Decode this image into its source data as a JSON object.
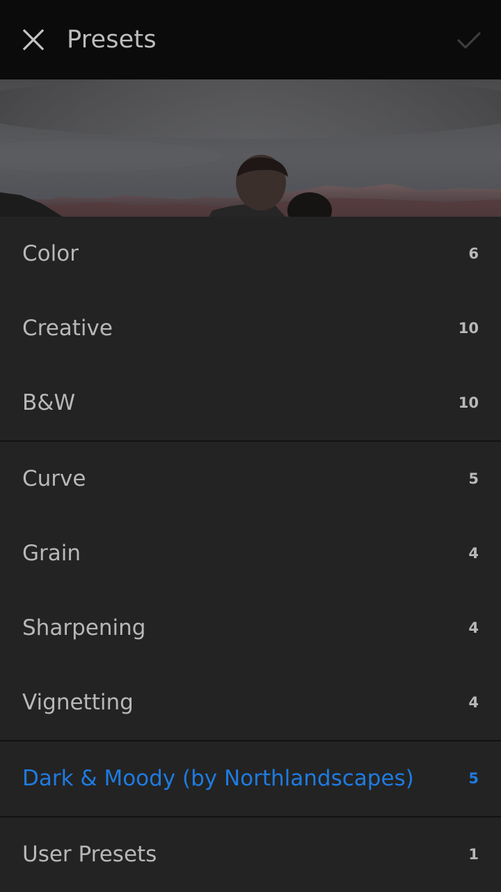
{
  "header": {
    "title": "Presets",
    "close_icon": "close-icon",
    "confirm_icon": "checkmark-icon"
  },
  "preview": {
    "description_icon": "photo-preview"
  },
  "groups": [
    {
      "items": [
        {
          "label": "Color",
          "count": "6"
        },
        {
          "label": "Creative",
          "count": "10"
        },
        {
          "label": "B&W",
          "count": "10"
        }
      ]
    },
    {
      "items": [
        {
          "label": "Curve",
          "count": "5"
        },
        {
          "label": "Grain",
          "count": "4"
        },
        {
          "label": "Sharpening",
          "count": "4"
        },
        {
          "label": "Vignetting",
          "count": "4"
        }
      ]
    },
    {
      "items": [
        {
          "label": "Dark & Moody (by Northlandscapes)",
          "count": "5",
          "active": true
        }
      ]
    },
    {
      "items": [
        {
          "label": "User Presets",
          "count": "1"
        }
      ]
    }
  ],
  "colors": {
    "accent": "#1f7be0",
    "background": "#232323",
    "topbar": "#0b0b0b",
    "text": "#b8b8b8"
  }
}
